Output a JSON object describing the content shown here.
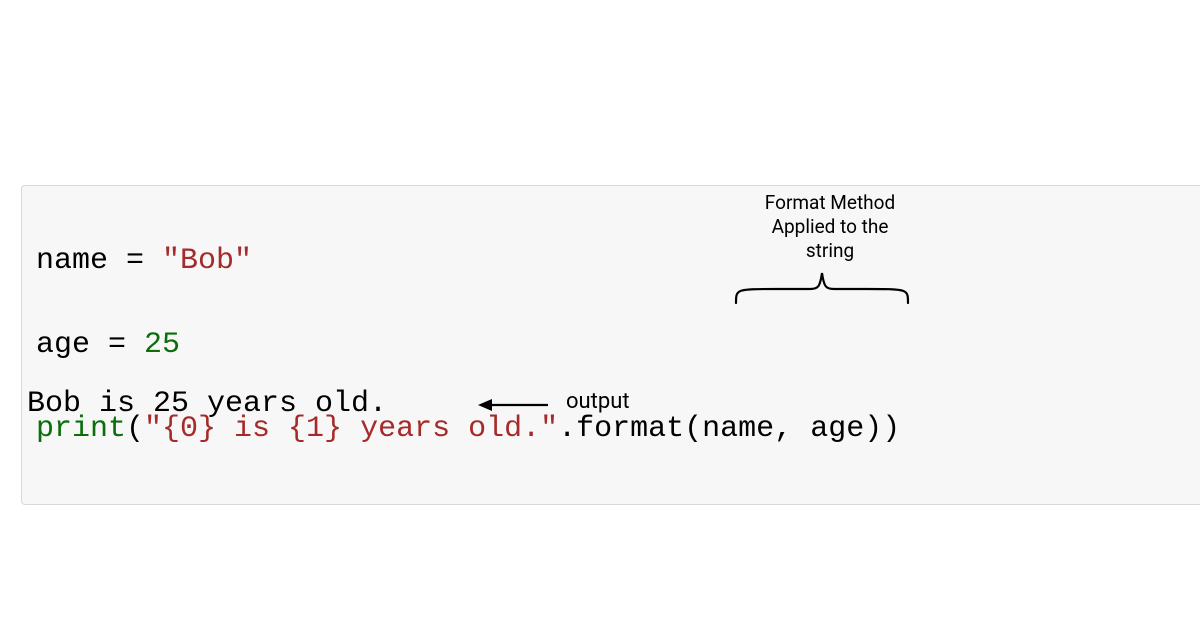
{
  "code": {
    "line1": {
      "var": "name",
      "eq": " = ",
      "str": "\"Bob\""
    },
    "line2": {
      "var": "age",
      "eq": " = ",
      "num": "25"
    },
    "line3": {
      "func": "print",
      "open": "(",
      "str": "\"{0} is {1} years old.\"",
      "dot": ".",
      "method": "format",
      "open2": "(",
      "arg1": "name",
      "comma": ", ",
      "arg2": "age",
      "close": "))"
    }
  },
  "annotation": {
    "top_line1": "Format Method",
    "top_line2": "Applied to the",
    "top_line3": "string"
  },
  "output": {
    "text": "Bob is 25 years old.",
    "label": "output"
  }
}
